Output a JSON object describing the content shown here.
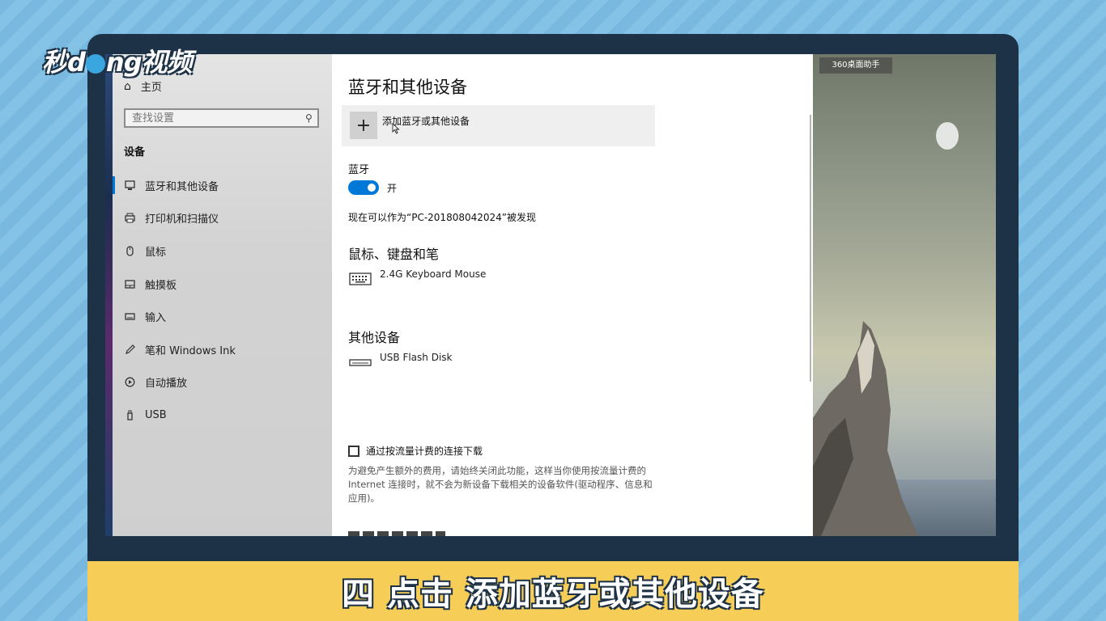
{
  "watermark": {
    "left": "秒",
    "middle": "d",
    "right": "ng视频"
  },
  "sidebar": {
    "home_label": "主页",
    "search_placeholder": "查找设置",
    "section_title": "设备",
    "items": [
      {
        "label": "蓝牙和其他设备",
        "icon": "bluetooth-devices-icon",
        "active": true
      },
      {
        "label": "打印机和扫描仪",
        "icon": "printer-icon"
      },
      {
        "label": "鼠标",
        "icon": "mouse-icon"
      },
      {
        "label": "触摸板",
        "icon": "touchpad-icon"
      },
      {
        "label": "输入",
        "icon": "keyboard-icon"
      },
      {
        "label": "笔和 Windows Ink",
        "icon": "pen-icon"
      },
      {
        "label": "自动播放",
        "icon": "autoplay-icon"
      },
      {
        "label": "USB",
        "icon": "usb-icon"
      }
    ]
  },
  "main": {
    "title": "蓝牙和其他设备",
    "add_device_label": "添加蓝牙或其他设备",
    "bluetooth_label": "蓝牙",
    "toggle_state": "开",
    "discoverable_text": "现在可以作为“PC-201808042024”被发现",
    "mouse_section_title": "鼠标、键盘和笔",
    "mouse_device": "2.4G Keyboard Mouse",
    "other_section_title": "其他设备",
    "other_device": "USB Flash Disk",
    "metered_checkbox_label": "通过按流量计费的连接下载",
    "metered_desc": "为避免产生额外的费用，请始终关闭此功能，这样当你使用按流量计费的 Internet 连接时，就不会为新设备下载相关的设备软件(驱动程序、信息和应用)。"
  },
  "wallpaper": {
    "helper_label": "360桌面助手"
  },
  "caption": "四 点击 添加蓝牙或其他设备",
  "colors": {
    "accent": "#0078d7",
    "caption_bg": "#f6cd56",
    "frame": "#1d3246"
  }
}
